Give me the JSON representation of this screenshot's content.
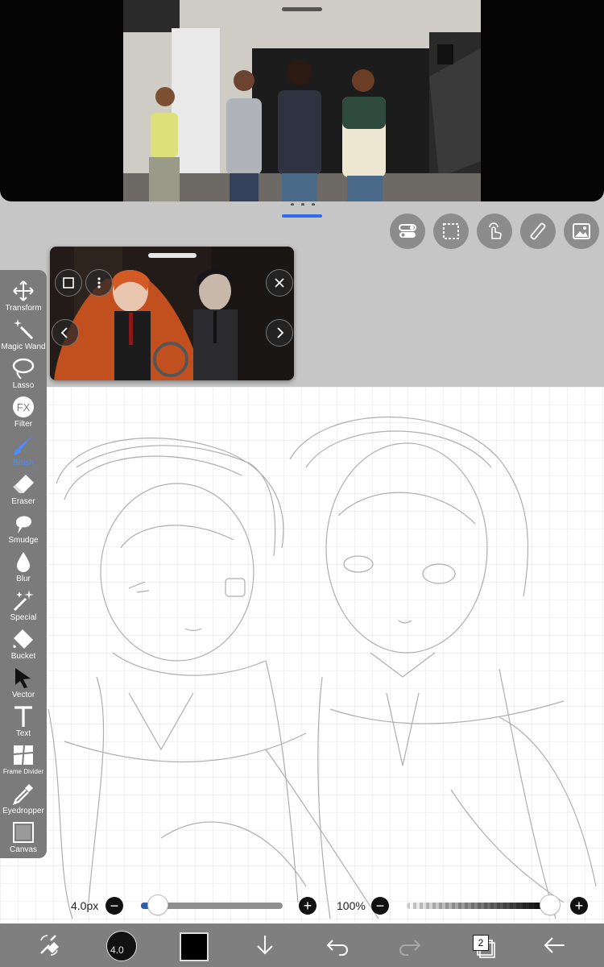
{
  "colors": {
    "toolbar_bg": "#7b7b7b",
    "active_accent": "#4d8dff",
    "split_accent": "#2f6ee8",
    "bottom_bar_bg": "#7f7f7f",
    "current_color": "#000000"
  },
  "top_tools": [
    {
      "name": "toggle-icon"
    },
    {
      "name": "selection-icon"
    },
    {
      "name": "touch-gesture-icon"
    },
    {
      "name": "ruler-icon"
    },
    {
      "name": "image-icon"
    }
  ],
  "toolbar": {
    "active": "Brush",
    "tools": [
      {
        "label": "Transform",
        "icon": "transform-icon"
      },
      {
        "label": "Magic Wand",
        "icon": "magic-wand-icon"
      },
      {
        "label": "Lasso",
        "icon": "lasso-icon"
      },
      {
        "label": "Filter",
        "icon": "filter-fx-icon"
      },
      {
        "label": "Brush",
        "icon": "brush-icon"
      },
      {
        "label": "Eraser",
        "icon": "eraser-icon"
      },
      {
        "label": "Smudge",
        "icon": "smudge-icon"
      },
      {
        "label": "Blur",
        "icon": "blur-drop-icon"
      },
      {
        "label": "Special",
        "icon": "special-icon"
      },
      {
        "label": "Bucket",
        "icon": "bucket-icon"
      },
      {
        "label": "Vector",
        "icon": "vector-cursor-icon"
      },
      {
        "label": "Text",
        "icon": "text-icon"
      },
      {
        "label": "Frame Divider",
        "icon": "frame-divider-icon"
      },
      {
        "label": "Eyedropper",
        "icon": "eyedropper-icon"
      },
      {
        "label": "Canvas",
        "icon": "canvas-icon"
      }
    ]
  },
  "sliders": {
    "size_label": "4.0px",
    "size_value": 0.05,
    "opacity_label": "100%",
    "opacity_value": 1.0
  },
  "bottom_bar": {
    "brush_size": "4.0",
    "layer_count": "2"
  }
}
